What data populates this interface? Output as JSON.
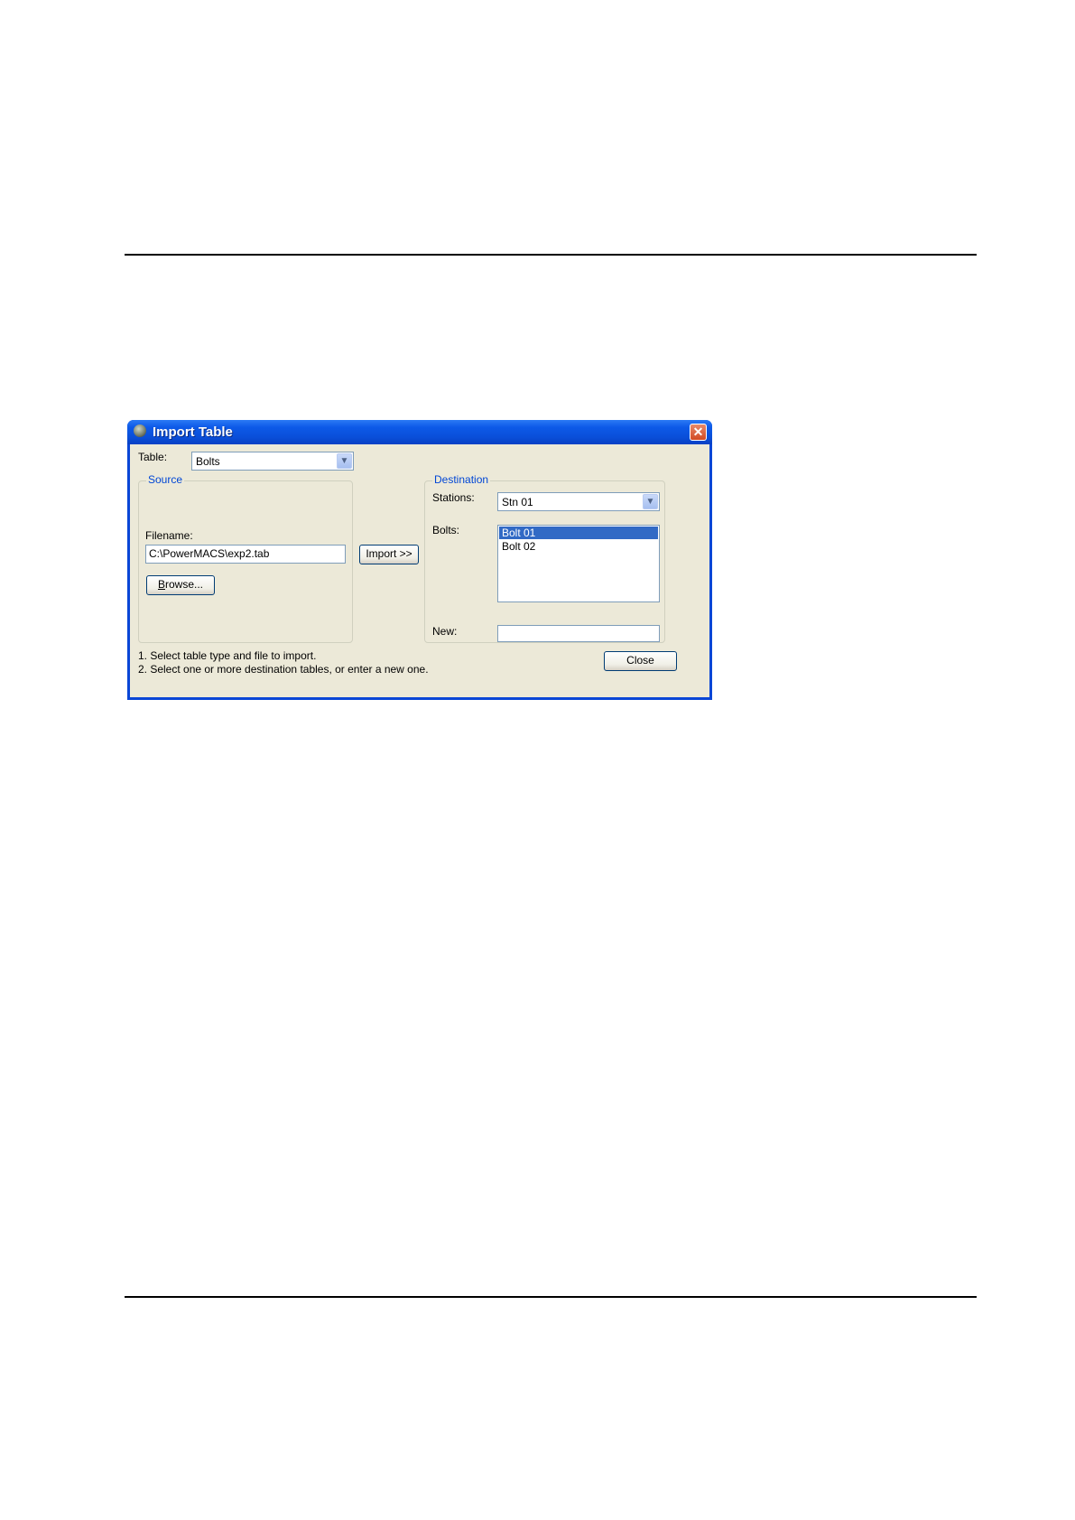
{
  "dialog": {
    "title": "Import Table",
    "table_label": "Table:",
    "table_value": "Bolts",
    "source": {
      "legend": "Source",
      "filename_label": "Filename:",
      "filename_value": "C:\\PowerMACS\\exp2.tab",
      "browse_label": "Browse..."
    },
    "import_label": "Import >>",
    "destination": {
      "legend": "Destination",
      "stations_label": "Stations:",
      "stations_value": "Stn 01",
      "bolts_label": "Bolts:",
      "bolts_items": [
        "Bolt 01",
        "Bolt 02"
      ],
      "selected_index": 0,
      "new_label": "New:",
      "new_value": ""
    },
    "instructions": [
      "1. Select table type and file to import.",
      "2. Select one or more destination tables, or enter a new one."
    ],
    "close_label": "Close"
  },
  "icons": {
    "close": "close-icon",
    "dropdown": "chevron-down-icon",
    "app": "app-icon"
  },
  "colors": {
    "titlebar": "#0a4fd9",
    "selection": "#316ac5",
    "legend": "#0046d5",
    "client": "#ece9d8"
  }
}
